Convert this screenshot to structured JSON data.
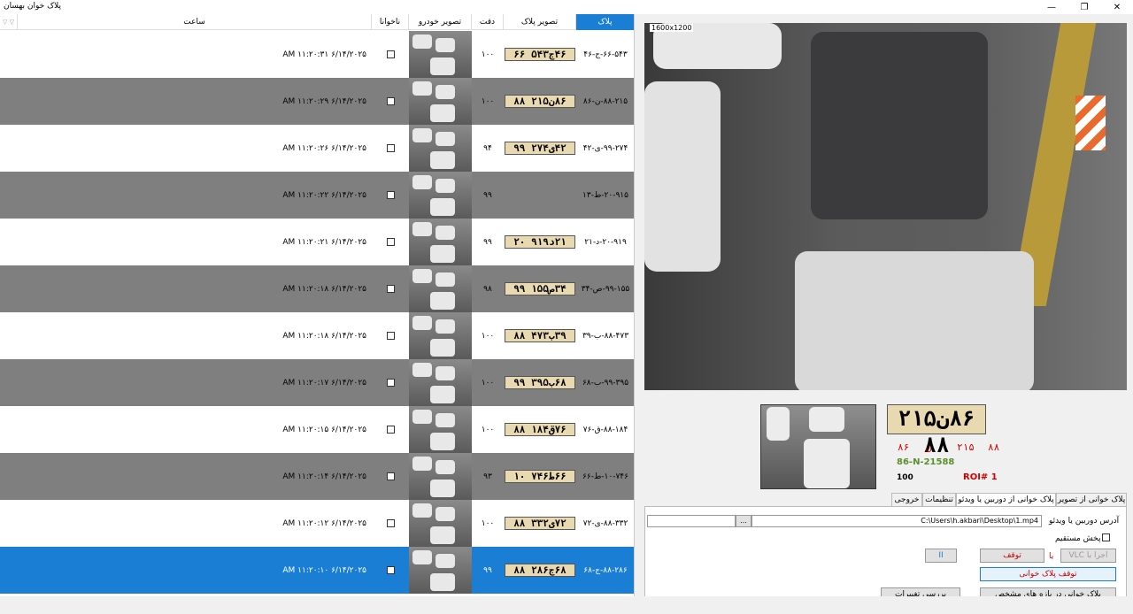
{
  "window": {
    "title": "پلاک خوان بهسان",
    "min": "—",
    "max": "❐",
    "close": "✕"
  },
  "grid": {
    "columns": {
      "time": "ساعت",
      "alien": "ناخوانا",
      "car_image": "تصویر خودرو",
      "accuracy": "دقت",
      "plate_image": "تصویر پلاک",
      "plate": "پلاک"
    },
    "corner": "▽ ▽",
    "rows": [
      {
        "time": "AM ۱۱:۲۰:۳۱ ۶/۱۴/۲۰۲۵",
        "accuracy": "۱۰۰",
        "plate_img": "۴۶ج۵۴۳ ۶۶",
        "plate": "۶۶-۵۴۳-ج-۴۶",
        "style": "white"
      },
      {
        "time": "AM ۱۱:۲۰:۲۹ ۶/۱۴/۲۰۲۵",
        "accuracy": "۱۰۰",
        "plate_img": "۸۶ن۲۱۵ ۸۸",
        "plate": "۸۸-۲۱۵-ن-۸۶",
        "style": "gray"
      },
      {
        "time": "AM ۱۱:۲۰:۲۶ ۶/۱۴/۲۰۲۵",
        "accuracy": "۹۴",
        "plate_img": "۴۲ی۲۷۴ ۹۹",
        "plate": "۹۹-۲۷۴-ی-۴۲",
        "style": "white"
      },
      {
        "time": "AM ۱۱:۲۰:۲۲ ۶/۱۴/۲۰۲۵",
        "accuracy": "۹۹",
        "plate_img": "",
        "plate": "۲۰-۹۱۵-ط-۱۳",
        "style": "gray"
      },
      {
        "time": "AM ۱۱:۲۰:۲۱ ۶/۱۴/۲۰۲۵",
        "accuracy": "۹۹",
        "plate_img": "۲۱د۹۱۹ ۲۰",
        "plate": "۲۰-۹۱۹-د-۲۱",
        "style": "white"
      },
      {
        "time": "AM ۱۱:۲۰:۱۸ ۶/۱۴/۲۰۲۵",
        "accuracy": "۹۸",
        "plate_img": "۳۴ص۱۵۵ ۹۹",
        "plate": "۹۹-۱۵۵-ص-۳۴",
        "style": "gray"
      },
      {
        "time": "AM ۱۱:۲۰:۱۸ ۶/۱۴/۲۰۲۵",
        "accuracy": "۱۰۰",
        "plate_img": "۳۹ب۴۷۳ ۸۸",
        "plate": "۸۸-۴۷۳-ب-۳۹",
        "style": "white"
      },
      {
        "time": "AM ۱۱:۲۰:۱۷ ۶/۱۴/۲۰۲۵",
        "accuracy": "۱۰۰",
        "plate_img": "۶۸ب۳۹۵ ۹۹",
        "plate": "۹۹-۳۹۵-ب-۶۸",
        "style": "gray"
      },
      {
        "time": "AM ۱۱:۲۰:۱۵ ۶/۱۴/۲۰۲۵",
        "accuracy": "۱۰۰",
        "plate_img": "۷۶ق۱۸۴ ۸۸",
        "plate": "۸۸-۱۸۴-ق-۷۶",
        "style": "white"
      },
      {
        "time": "AM ۱۱:۲۰:۱۴ ۶/۱۴/۲۰۲۵",
        "accuracy": "۹۳",
        "plate_img": "۶۶ط۷۴۶ ۱۰",
        "plate": "۱۰-۷۴۶-ط-۶۶",
        "style": "gray"
      },
      {
        "time": "AM ۱۱:۲۰:۱۲ ۶/۱۴/۲۰۲۵",
        "accuracy": "۱۰۰",
        "plate_img": "۷۲ی۳۳۲ ۸۸",
        "plate": "۸۸-۳۳۲-ی-۷۲",
        "style": "white"
      },
      {
        "time": "AM ۱۱:۲۰:۱۰ ۶/۱۴/۲۰۲۵",
        "accuracy": "۹۹",
        "plate_img": "۶۸ج۲۸۶ ۸۸",
        "plate": "۸۸-۲۸۶-ج-۶۸",
        "style": "blue"
      }
    ]
  },
  "viewer": {
    "resolution": "1600x1200",
    "plate_zoom": "۸۶ن۲۱۵ ۸۸",
    "segments": [
      "۸۸",
      "۲۱۵",
      "ن",
      "۸۶"
    ],
    "latin": "86-N-21588",
    "score": "100",
    "roi": "ROI# 1"
  },
  "tabs": [
    "پلاک خوانی از تصویر",
    "پلاک خوانی از دوربین یا ویدئو",
    "تنظیمات",
    "خروجی"
  ],
  "panel": {
    "address_label": "آدرس دوربین یا ویدئو",
    "address_value": "C:\\Users\\h.akbari\\Desktop\\1.mp4",
    "browse": "...",
    "live_label": "پخش مستقیم",
    "vlc_button": "اجرا با VLC",
    "or": "یا",
    "stop": "توقف",
    "pause": "II",
    "stop_reading": "توقف پلاک خوانی",
    "range_reading": "پلاک خوانی در بازه های مشخص",
    "review_changes": "بررسی تغییرات"
  }
}
